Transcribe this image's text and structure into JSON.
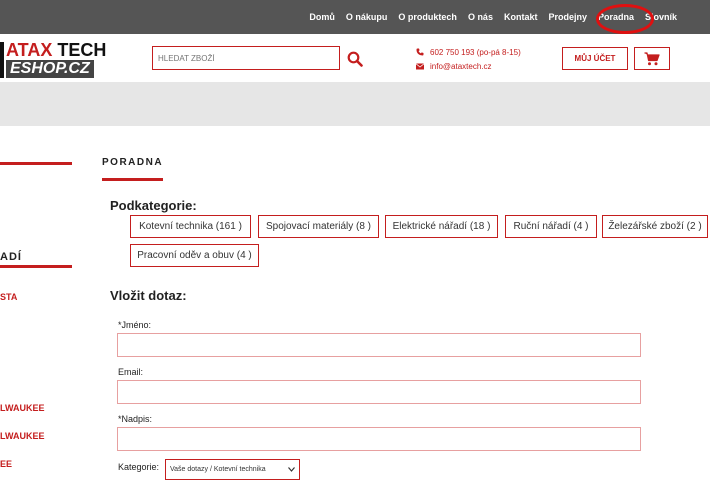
{
  "topnav": {
    "items": [
      "Domů",
      "O nákupu",
      "O produktech",
      "O nás",
      "Kontakt",
      "Prodejny",
      "Poradna",
      "Slovník"
    ]
  },
  "logo": {
    "line1_a": "ATAX",
    "line1_b": "TECH",
    "line2": "ESHOP.CZ"
  },
  "search": {
    "placeholder": "HLEDAT ZBOŽÍ"
  },
  "contact": {
    "phone": "602 750 193 (po-pá 8-15)",
    "email": "info@ataxtech.cz"
  },
  "account": {
    "label": "MŮJ ÚČET"
  },
  "sidebar": {
    "heading": "ADÍ",
    "items": [
      "STA",
      "LWAUKEE",
      "LWAUKEE",
      "EE"
    ]
  },
  "main": {
    "title": "PORADNA",
    "subcategory_label": "Podkategorie:",
    "subcategories": [
      "Kotevní technika (161 )",
      "Spojovací materiály (8 )",
      "Elektrické nářadí (18 )",
      "Ruční nářadí (4 )",
      "Železářské zboží (2 )",
      "Pracovní oděv a obuv (4 )"
    ],
    "ask_label": "Vložit dotaz:",
    "form": {
      "name_label": "*Jméno:",
      "email_label": "Email:",
      "subject_label": "*Nadpis:",
      "category_label": "Kategorie:",
      "category_value": "Vaše dotazy / Kotevní technika"
    }
  },
  "colors": {
    "accent": "#c41e1e",
    "topbar": "#555555",
    "banner": "#e6e6e6"
  }
}
